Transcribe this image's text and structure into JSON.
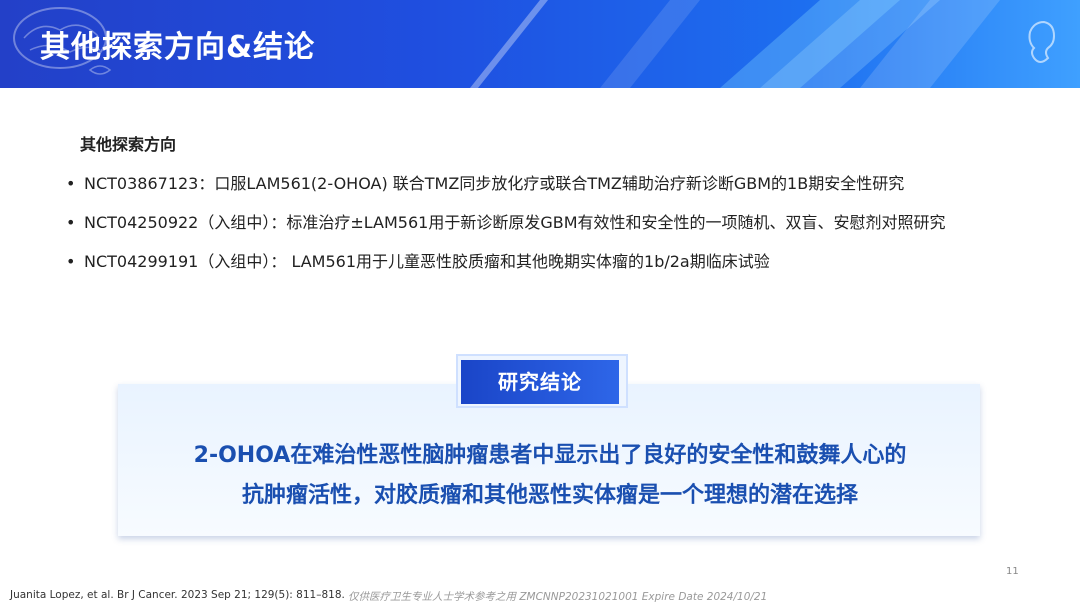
{
  "header": {
    "title": "其他探索方向&结论"
  },
  "section": {
    "heading": "其他探索方向",
    "bullets": [
      "NCT03867123：口服LAM561(2-OHOA) 联合TMZ同步放化疗或联合TMZ辅助治疗新诊断GBM的1B期安全性研究",
      "NCT04250922（入组中）：标准治疗±LAM561用于新诊断原发GBM有效性和安全性的一项随机、双盲、安慰剂对照研究",
      "NCT04299191（入组中）： LAM561用于儿童恶性胶质瘤和其他晚期实体瘤的1b/2a期临床试验"
    ]
  },
  "conclusion": {
    "tag": "研究结论",
    "line1": "2-OHOA在难治性恶性脑肿瘤患者中显示出了良好的安全性和鼓舞人心的",
    "line2": "抗肿瘤活性，对胶质瘤和其他恶性实体瘤是一个理想的潜在选择"
  },
  "footer": {
    "reference": "Juanita Lopez, et al. Br J Cancer. 2023 Sep 21; 129(5): 811–818.",
    "note": "仅供医疗卫生专业人士学术参考之用 ZMCNNP20231021001 Expire Date 2024/10/21",
    "page": "11"
  },
  "colors": {
    "header_start": "#2340c8",
    "header_end": "#3fa0ff",
    "conclusion_text": "#1a4fb0",
    "tag_bg": "#1a45c8"
  }
}
